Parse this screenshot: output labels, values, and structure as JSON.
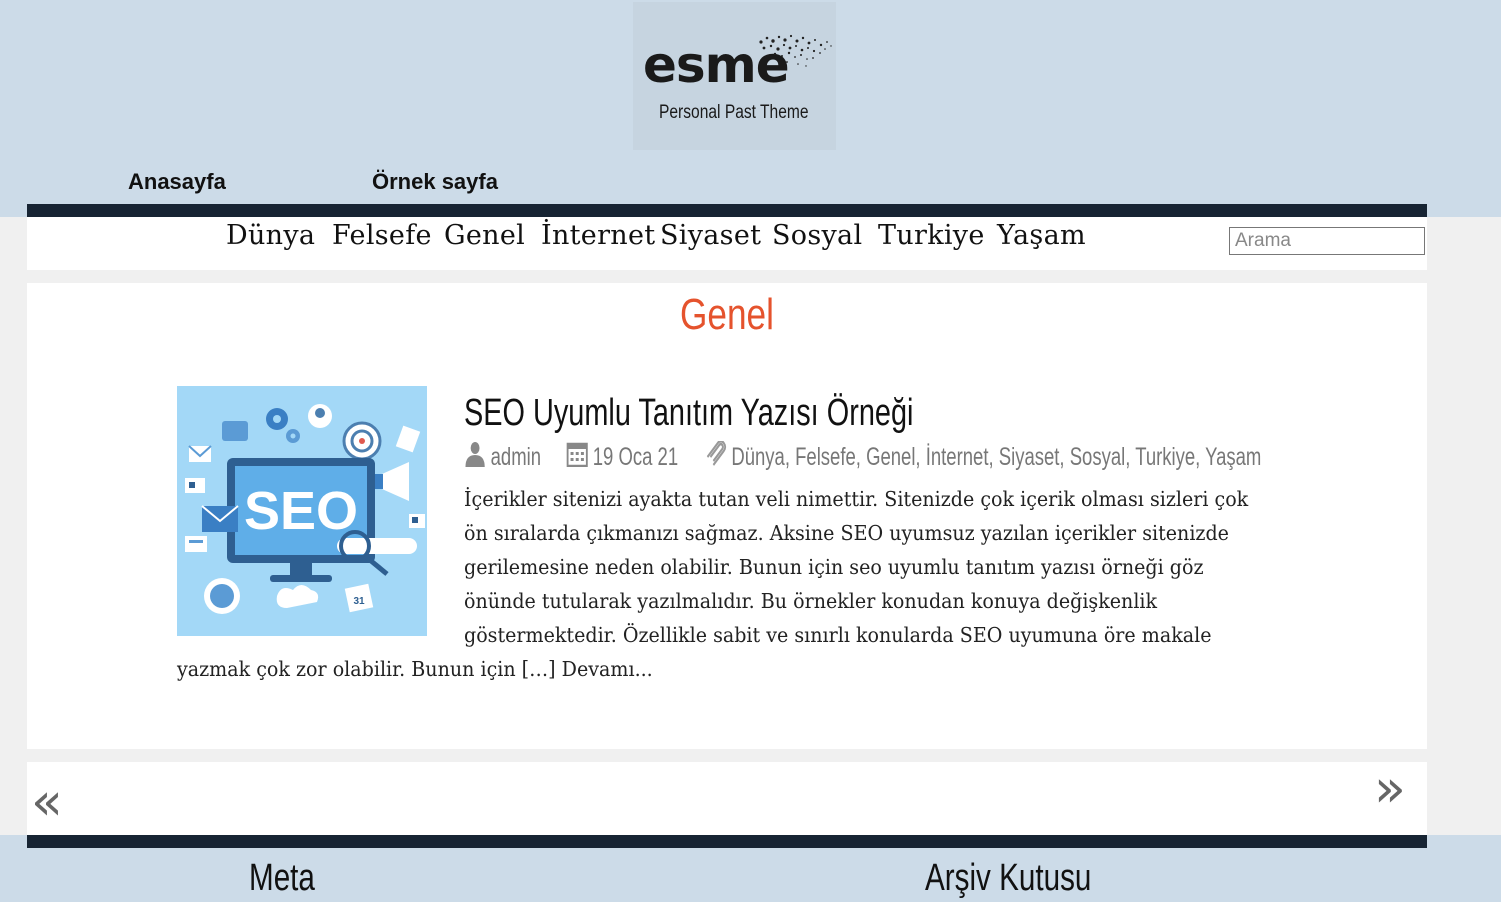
{
  "brand": {
    "logo_word": "esme",
    "logo_tagline": "Personal Past Theme"
  },
  "primary_nav": [
    "Anasayfa",
    "Örnek sayfa"
  ],
  "category_nav": [
    "Dünya",
    "Felsefe",
    "Genel",
    "İnternet",
    "Siyaset",
    "Sosyal",
    "Turkiye",
    "Yaşam"
  ],
  "search": {
    "placeholder": "Arama"
  },
  "page": {
    "title": "Genel"
  },
  "post": {
    "thumbnail_text": "SEO",
    "title": "SEO Uyumlu Tanıtım Yazısı Örneği",
    "author": "admin",
    "date": "19 Oca 21",
    "categories": [
      "Dünya",
      "Felsefe",
      "Genel",
      "İnternet",
      "Siyaset",
      "Sosyal",
      "Turkiye",
      "Yaşam"
    ],
    "excerpt_lines": [
      "İçerikler sitenizi ayakta tutan veli nimettir. Sitenizde çok içerik olması sizleri çok",
      "ön sıralarda çıkmanızı sağmaz. Aksine SEO uyumsuz yazılan içerikler sitenizde",
      "gerilemesine neden olabilir. Bunun için seo uyumlu tanıtım yazısı örneği göz",
      "önünde tutularak yazılmalıdır. Bu örnekler konudan konuya değişkenlik",
      "göstermektedir. Özellikle sabit ve sınırlı konularda SEO uyumuna öre makale"
    ],
    "excerpt_last": "yazmak çok zor olabilir. Bunun için […] ",
    "read_more": "Devamı..."
  },
  "pager": {
    "prev": "«",
    "next": "»"
  },
  "footer": {
    "widgets": [
      "Meta",
      "Arşiv Kutusu"
    ]
  },
  "colors": {
    "band": "#ccdbe8",
    "dark_bar": "#172433",
    "accent": "#e5532d",
    "thumb_bg": "#9fd4f5"
  },
  "icons": [
    "user-icon",
    "calendar-icon",
    "paperclip-icon",
    "prev-page-icon",
    "next-page-icon"
  ]
}
